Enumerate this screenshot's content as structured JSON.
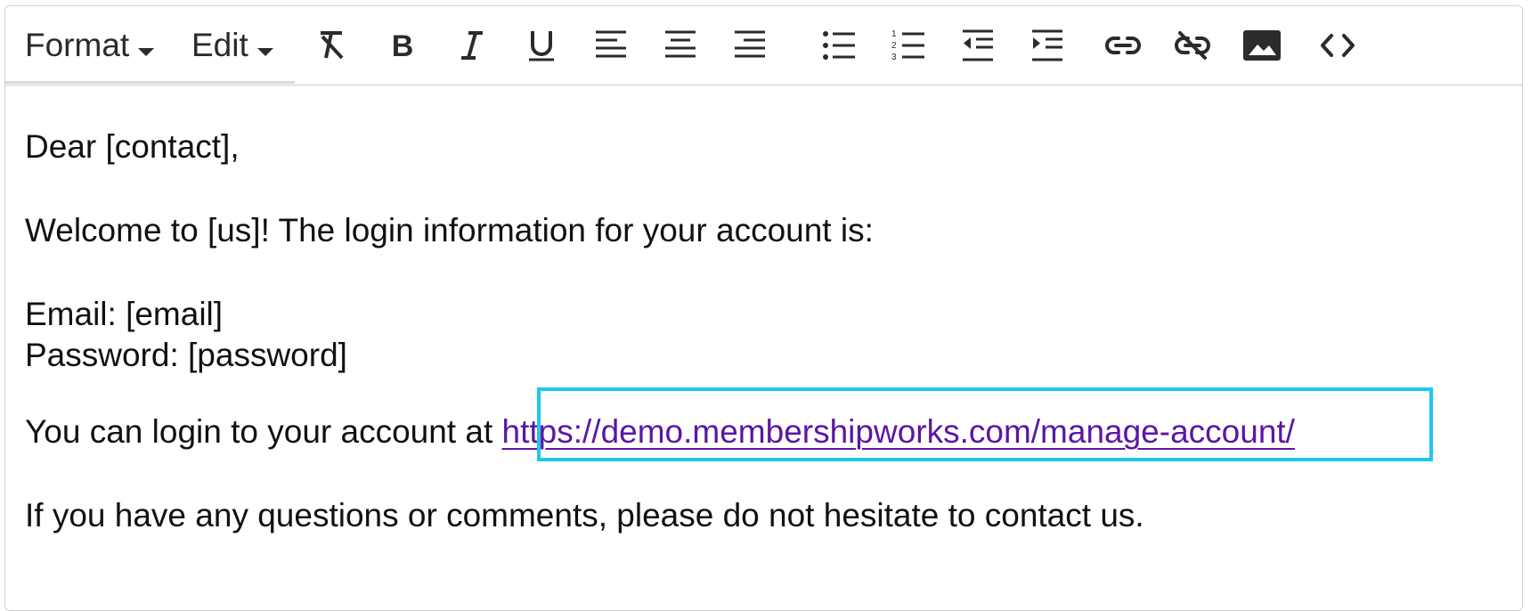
{
  "toolbar": {
    "format_label": "Format",
    "edit_label": "Edit",
    "buttons": [
      {
        "name": "clear-formatting",
        "icon": "clear-format-icon"
      },
      {
        "name": "bold",
        "icon": "bold-icon"
      },
      {
        "name": "italic",
        "icon": "italic-icon"
      },
      {
        "name": "underline",
        "icon": "underline-icon"
      },
      {
        "name": "align-left",
        "icon": "align-left-icon"
      },
      {
        "name": "align-center",
        "icon": "align-center-icon"
      },
      {
        "name": "align-right",
        "icon": "align-right-icon"
      },
      {
        "name": "bullet-list",
        "icon": "bullet-list-icon"
      },
      {
        "name": "numbered-list",
        "icon": "numbered-list-icon"
      },
      {
        "name": "outdent",
        "icon": "outdent-icon"
      },
      {
        "name": "indent",
        "icon": "indent-icon"
      },
      {
        "name": "insert-link",
        "icon": "link-icon"
      },
      {
        "name": "remove-link",
        "icon": "unlink-icon"
      },
      {
        "name": "insert-image",
        "icon": "image-icon"
      },
      {
        "name": "source-code",
        "icon": "code-icon"
      }
    ]
  },
  "body": {
    "greeting": "Dear [contact],",
    "welcome": "Welcome to [us]! The login information for your account is:",
    "email_line": "Email: [email]",
    "password_line": "Password: [password]",
    "login_prefix": "You can login to your account at ",
    "login_url": "https://demo.membershipworks.com/manage-account/",
    "closing": "If you have any questions or comments, please do not hesitate to contact us."
  },
  "colors": {
    "link": "#5b16a3",
    "highlight_border": "#1fc7ef",
    "border": "#cfcfcf"
  }
}
